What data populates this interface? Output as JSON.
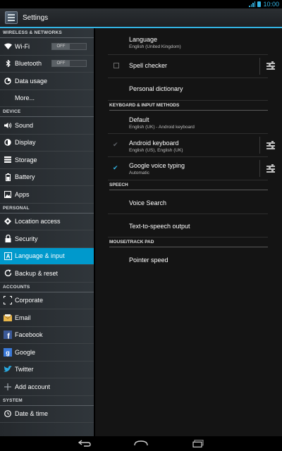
{
  "status": {
    "time": "10:00"
  },
  "app": {
    "title": "Settings"
  },
  "sidebar": {
    "wireless_header": "WIRELESS & NETWORKS",
    "wifi": {
      "label": "Wi-Fi",
      "toggle": "OFF"
    },
    "bluetooth": {
      "label": "Bluetooth",
      "toggle": "OFF"
    },
    "data_usage": "Data usage",
    "more": "More...",
    "device_header": "DEVICE",
    "sound": "Sound",
    "display": "Display",
    "storage": "Storage",
    "battery": "Battery",
    "apps": "Apps",
    "personal_header": "PERSONAL",
    "location": "Location access",
    "security": "Security",
    "language": "Language & input",
    "backup": "Backup & reset",
    "accounts_header": "ACCOUNTS",
    "corporate": "Corporate",
    "email": "Email",
    "facebook": "Facebook",
    "google": "Google",
    "twitter": "Twitter",
    "add_account": "Add account",
    "system_header": "SYSTEM",
    "date_time": "Date & time"
  },
  "main": {
    "language": {
      "title": "Language",
      "sub": "English (United Kingdom)"
    },
    "spell_checker": "Spell checker",
    "personal_dictionary": "Personal dictionary",
    "keyboard_header": "KEYBOARD & INPUT METHODS",
    "default": {
      "title": "Default",
      "sub": "English (UK) - Android keyboard"
    },
    "android_keyboard": {
      "title": "Android keyboard",
      "sub": "English (US), English (UK)"
    },
    "google_voice": {
      "title": "Google voice typing",
      "sub": "Automatic"
    },
    "speech_header": "SPEECH",
    "voice_search": "Voice Search",
    "tts": "Text-to-speech output",
    "mouse_header": "MOUSE/TRACK PAD",
    "pointer_speed": "Pointer speed"
  },
  "colors": {
    "accent": "#33b5e5",
    "selected": "#0099cc"
  }
}
